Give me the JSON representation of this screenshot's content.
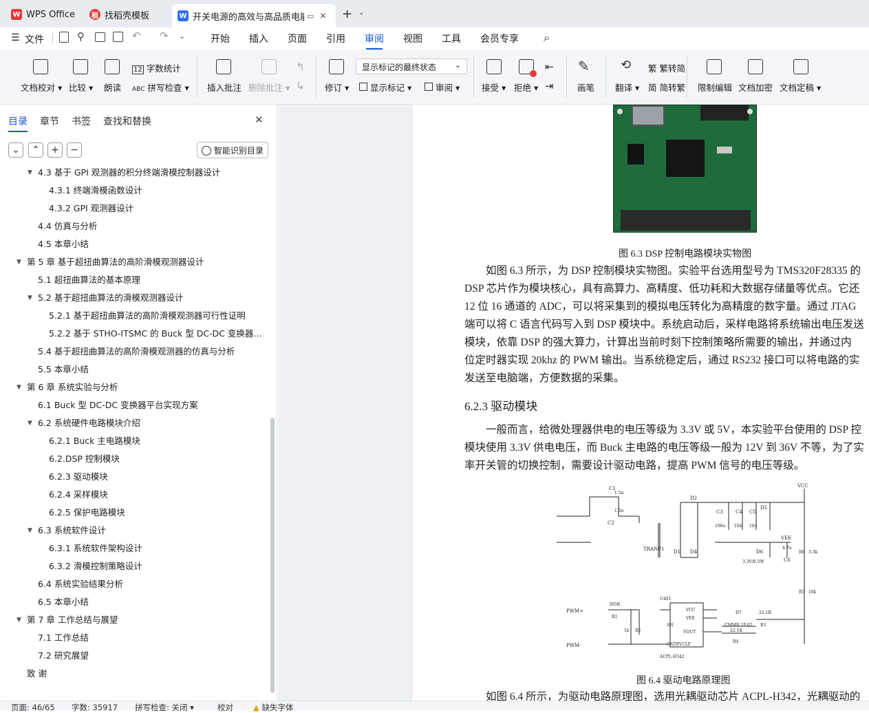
{
  "titlebar": {
    "tabs": [
      {
        "label": "WPS Office",
        "icon": "wps-logo-icon"
      },
      {
        "label": "找稻壳模板",
        "icon": "daoke-logo-icon"
      },
      {
        "label": "开关电源的高效与高品质电能",
        "icon": "writer-doc-icon"
      }
    ]
  },
  "menubar": {
    "file": "文件",
    "items": [
      "开始",
      "插入",
      "页面",
      "引用",
      "审阅",
      "视图",
      "工具",
      "会员专享"
    ],
    "active": "审阅"
  },
  "ribbon": {
    "doc_check": "文档校对",
    "compare": "比较",
    "read_aloud": "朗读",
    "word_count": "字数统计",
    "spell_check": "拼写检查",
    "insert_comment": "插入批注",
    "delete_comment": "删除批注",
    "revise": "修订",
    "markup_mode": "显示标记的最终状态",
    "show_markup": "显示标记",
    "review": "审阅",
    "accept": "接受",
    "reject": "拒绝",
    "pen": "画笔",
    "translate": "翻译",
    "to_traditional": "繁转简",
    "to_simplified": "简转繁",
    "restrict_edit": "限制编辑",
    "encrypt": "文档加密",
    "finalize": "文档定稿"
  },
  "nav": {
    "tabs": [
      "目录",
      "章节",
      "书签",
      "查找和替换"
    ],
    "smart_toc": "智能识别目录",
    "items": [
      {
        "text": "4.3 基于 GPI 观测器的积分终端滑模控制器设计",
        "level": 2,
        "arrow": true
      },
      {
        "text": "4.3.1 终端滑模函数设计",
        "level": 3
      },
      {
        "text": "4.3.2 GPI 观测器设计",
        "level": 3
      },
      {
        "text": "4.4 仿真与分析",
        "level": 2
      },
      {
        "text": "4.5 本章小结",
        "level": 2
      },
      {
        "text": "第 5 章  基于超扭曲算法的高阶滑模观测器设计",
        "level": 1,
        "arrow": true
      },
      {
        "text": "5.1 超扭曲算法的基本原理",
        "level": 2
      },
      {
        "text": "5.2 基于超扭曲算法的滑模观测器设计",
        "level": 2,
        "arrow": true
      },
      {
        "text": "5.2.1 基于超扭曲算法的高阶滑模观测器可行性证明",
        "level": 3
      },
      {
        "text": "5.2.2 基于 STHO-ITSMC 的 Buck 型 DC-DC 变换器的控制...",
        "level": 3
      },
      {
        "text": "5.4 基于超扭曲算法的高阶滑模观测器的仿真与分析",
        "level": 2
      },
      {
        "text": "5.5 本章小结",
        "level": 2
      },
      {
        "text": "第 6 章  系统实验与分析",
        "level": 1,
        "arrow": true
      },
      {
        "text": "6.1 Buck 型 DC-DC 变换器平台实现方案",
        "level": 2
      },
      {
        "text": "6.2 系统硬件电路模块介绍",
        "level": 2,
        "arrow": true
      },
      {
        "text": "6.2.1 Buck 主电路模块",
        "level": 3
      },
      {
        "text": "6.2.DSP 控制模块",
        "level": 3
      },
      {
        "text": "6.2.3 驱动模块",
        "level": 3
      },
      {
        "text": "6.2.4 采样模块",
        "level": 3
      },
      {
        "text": "6.2.5 保护电路模块",
        "level": 3
      },
      {
        "text": "6.3 系统软件设计",
        "level": 2,
        "arrow": true
      },
      {
        "text": "6.3.1 系统软件架构设计",
        "level": 3
      },
      {
        "text": "6.3.2 滑模控制策略设计",
        "level": 3
      },
      {
        "text": "6.4 系统实验结果分析",
        "level": 2
      },
      {
        "text": "6.5 本章小结",
        "level": 2
      },
      {
        "text": "第 7 章  工作总结与展望",
        "level": 1,
        "arrow": true
      },
      {
        "text": "7.1 工作总结",
        "level": 2
      },
      {
        "text": "7.2 研究展望",
        "level": 2
      },
      {
        "text": "致   谢",
        "level": 1
      }
    ]
  },
  "document": {
    "fig63_caption": "图 6.3 DSP 控制电路模块实物图",
    "para1": [
      "如图 6.3 所示，为 DSP 控制模块实物图。实验平台选用型号为 TMS320F28335 的",
      "DSP 芯片作为模块核心，具有高算力、高精度、低功耗和大数据存储量等优点。它还",
      "12 位 16 通道的 ADC，可以将采集到的模拟电压转化为高精度的数字量。通过 JTAG",
      "端可以将 C 语言代码写入到 DSP 模块中。系统启动后，采样电路将系统输出电压发送",
      "模块，依靠 DSP 的强大算力，计算出当前时刻下控制策略所需要的输出，并通过内",
      "位定时器实现 20khz 的 PWM 输出。当系统稳定后，通过 RS232 接口可以将电路的实",
      "发送至电脑端，方便数据的采集。"
    ],
    "heading": "6.2.3 驱动模块",
    "para2": [
      "一般而言，给微处理器供电的电压等级为 3.3V 或 5V，本实验平台使用的 DSP 控",
      "模块使用 3.3V 供电电压，而 Buck 主电路的电压等级一般为 12V 到 36V 不等，为了实",
      "率开关管的切换控制，需要设计驱动电路，提高 PWM 信号的电压等级。"
    ],
    "fig64_caption": "图 6.4  驱动电路原理图",
    "para3": "如图 6.4 所示，为驱动电路原理图，选用光耦驱动芯片 ACPL-H342，光耦驱动的",
    "circuit_labels": {
      "c1": "C1",
      "c1v": "1.5n",
      "c2": "C2",
      "c2v": "1.5n",
      "tranf": "TRANF1",
      "d1": "D1",
      "d2": "D2",
      "d3": "D3",
      "d4": "D4",
      "d5": "D5",
      "d6": "D6",
      "c3": "C3",
      "c3v": "100u",
      "c4": "C4",
      "c4v": "104",
      "c5": "C5",
      "c5v": "104",
      "vcc": "VCC",
      "vee": "VEE",
      "zener": "3.3V/0.5W",
      "c6": "C6",
      "c6v": "4.7u",
      "r6": "R6",
      "r6v": "3.3k",
      "r5": "R5",
      "r5v": "10k",
      "pwm_p": "PWM+",
      "pwm_m": "PWM-",
      "r1": "R1",
      "r1v": "365R",
      "r2": "R2",
      "r2v": "1k",
      "u": "U401",
      "an": "AN",
      "cath": "CATHVCLP",
      "pvcc": "VCC",
      "pvee": "VEE",
      "vout": "VOUT",
      "chip": "ACPL-H342",
      "d7": "D7",
      "d7v": "CMMR 1F-02",
      "r3": "R3",
      "r3v": "22.1R",
      "r4": "R4",
      "r4v": "22.1R"
    }
  },
  "status": {
    "page": "页面: 46/65",
    "words": "字数: 35917",
    "spell": "拼写检查: 关闭",
    "proof": "校对",
    "missing_font": "缺失字体"
  }
}
